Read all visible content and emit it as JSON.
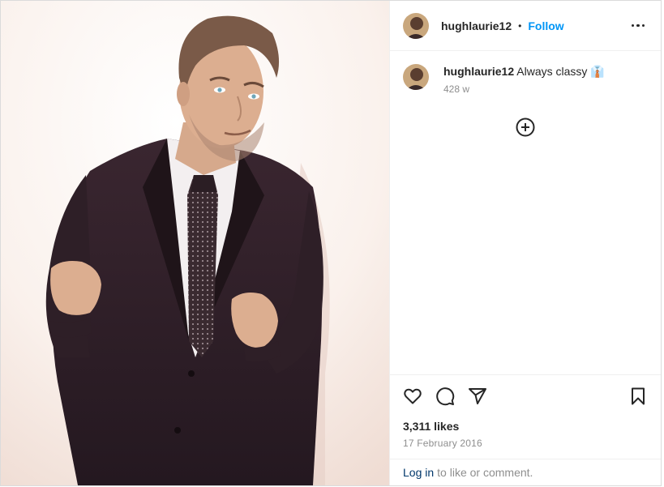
{
  "post": {
    "username": "hughlaurie12",
    "dot": "•",
    "follow_label": "Follow",
    "more_icon": "more-options-icon",
    "caption": {
      "username": "hughlaurie12",
      "text": "Always classy",
      "emoji": "👔"
    },
    "caption_time": "428 w",
    "load_more_icon": "plus-circle-icon",
    "likes": "3,311 likes",
    "date": "17 February 2016",
    "login": {
      "link": "Log in",
      "text": "to like or comment."
    }
  },
  "colors": {
    "accent": "#0095f6",
    "link": "#00376b",
    "muted": "#8e8e8e",
    "border": "#dbdbdb"
  }
}
